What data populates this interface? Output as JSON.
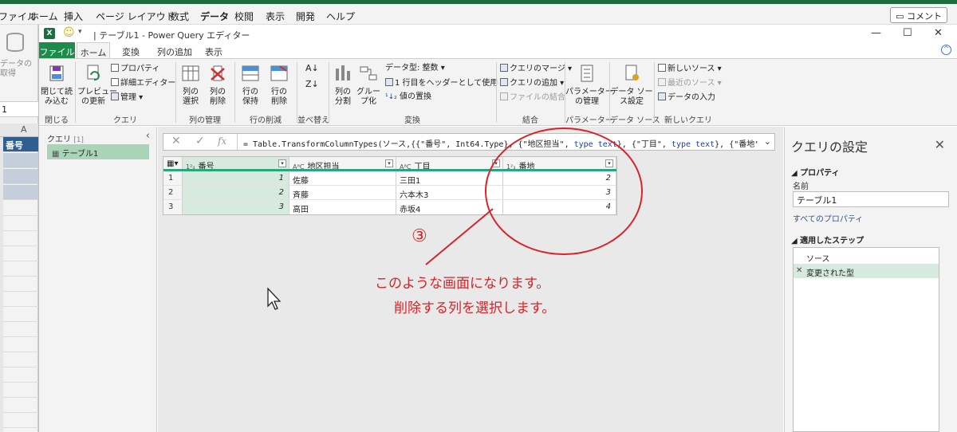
{
  "excel": {
    "tabs": [
      "ファイル",
      "ホーム",
      "挿入",
      "ページ レイアウト",
      "数式",
      "データ",
      "校閲",
      "表示",
      "開発",
      "ヘルプ"
    ],
    "active_tab": "データ",
    "comment_button": "コメント",
    "left_faded_1": "データの",
    "left_faded_2": "取得",
    "name_box": "1",
    "column_header": "A",
    "cell_header": "番号"
  },
  "pq": {
    "title": "テーブル1 - Power Query エディター",
    "tabs": {
      "file": "ファイル",
      "home": "ホーム",
      "transform": "変換",
      "add_column": "列の追加",
      "view": "表示"
    },
    "ribbon": {
      "close_load": "閉じて読\nみ込む",
      "close_group": "閉じる",
      "preview_refresh": "プレビュー\nの更新",
      "properties": "プロパティ",
      "advanced_editor": "詳細エディター",
      "manage": "管理",
      "query_group": "クエリ",
      "choose_columns": "列の\n選択",
      "remove_columns": "列の\n削除",
      "manage_columns_group": "列の管理",
      "keep_rows": "行の\n保持",
      "remove_rows": "行の\n削除",
      "reduce_rows_group": "行の削減",
      "sort_group": "並べ替え",
      "split_column": "列の\n分割",
      "group_by": "グルー\nプ化",
      "data_type": "データ型: 整数",
      "first_row_header": "1 行目をヘッダーとして使用",
      "replace_values": "値の置換",
      "transform_group": "変換",
      "merge_queries": "クエリのマージ",
      "append_queries": "クエリの追加",
      "combine_files": "ファイルの結合",
      "combine_group": "結合",
      "manage_params": "パラメーター\nの管理",
      "params_group": "パラメーター",
      "datasource_settings": "データ ソー\nス設定",
      "datasource_group": "データ ソース",
      "new_source": "新しいソース",
      "recent_sources": "最近のソース",
      "enter_data": "データの入力",
      "new_query_group": "新しいクエリ"
    },
    "queries": {
      "header": "クエリ",
      "count": "[1]",
      "item": "テーブル1"
    },
    "formula": {
      "prefix": "= Table.TransformColumnTypes(ソース,{{\"番号\", Int64.Type}, {\"地区担当\", ",
      "kw1": "type text",
      "mid": "}, {\"丁目\", ",
      "kw2": "type text",
      "suffix": "}, {\"番地\","
    },
    "grid": {
      "columns": [
        {
          "type": "1²₃",
          "name": "番号"
        },
        {
          "type": "AᴮC",
          "name": "地区担当"
        },
        {
          "type": "AᴮC",
          "name": "丁目"
        },
        {
          "type": "1²₃",
          "name": "番地"
        }
      ],
      "rows": [
        {
          "n": "1",
          "c1": "1",
          "c2": "佐藤",
          "c3": "三田1",
          "c4": "2"
        },
        {
          "n": "2",
          "c1": "2",
          "c2": "斉藤",
          "c3": "六本木3",
          "c4": "3"
        },
        {
          "n": "3",
          "c1": "3",
          "c2": "高田",
          "c3": "赤坂4",
          "c4": "4"
        }
      ]
    },
    "annotation": {
      "number": "③",
      "line1": "このような画面になります。",
      "line2": "削除する列を選択します。",
      "color": "#d8232a"
    },
    "settings": {
      "title": "クエリの設定",
      "properties": "プロパティ",
      "name_label": "名前",
      "name_value": "テーブル1",
      "all_properties": "すべてのプロパティ",
      "applied_steps": "適用したステップ",
      "steps": [
        "ソース",
        "変更された型"
      ]
    }
  }
}
